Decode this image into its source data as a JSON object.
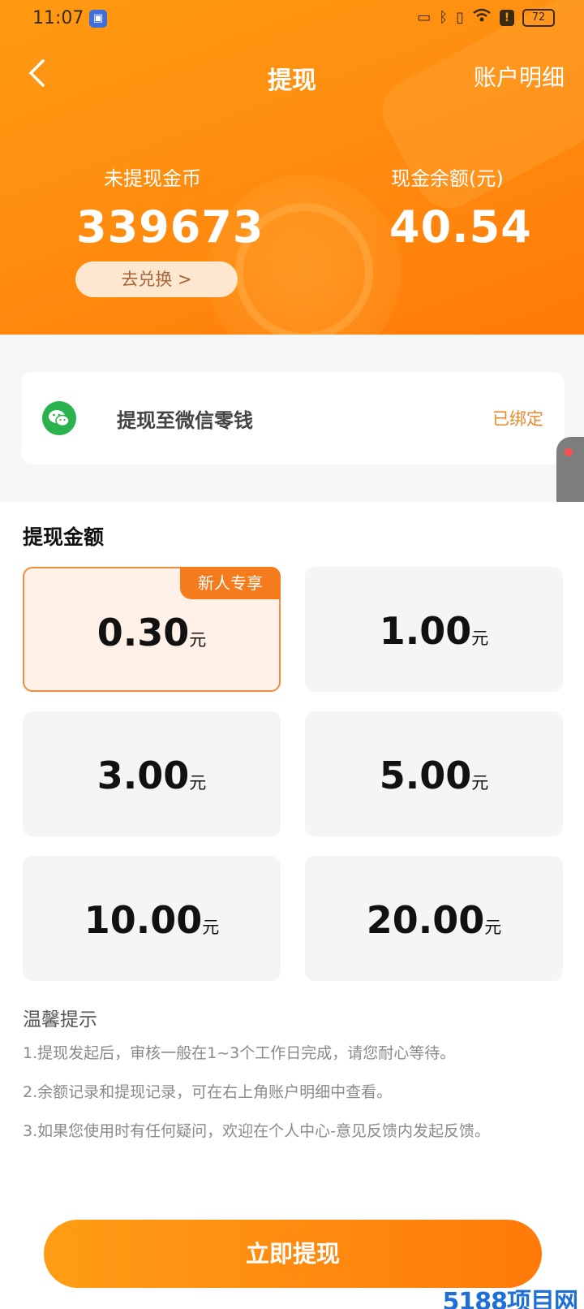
{
  "status_bar": {
    "time": "11:07",
    "battery": "72"
  },
  "nav": {
    "title": "提现",
    "right_link": "账户明细"
  },
  "stats": {
    "coins_label": "未提现金币",
    "coins_value": "339673",
    "cash_label": "现金余额(元)",
    "cash_value": "40.54",
    "exchange_button": "去兑换 >"
  },
  "wechat": {
    "label": "提现至微信零钱",
    "status": "已绑定"
  },
  "amount": {
    "title": "提现金额",
    "unit": "元",
    "badge": "新人专享",
    "options": [
      "0.30",
      "1.00",
      "3.00",
      "5.00",
      "10.00",
      "20.00"
    ]
  },
  "tips": {
    "title": "温馨提示",
    "items": [
      "1.提现发起后，审核一般在1~3个工作日完成，请您耐心等待。",
      "2.余额记录和提现记录，可在右上角账户明细中查看。",
      "3.如果您使用时有任何疑问，欢迎在个人中心-意见反馈内发起反馈。"
    ]
  },
  "submit_button": "立即提现",
  "watermark": "5188项目网",
  "colors": {
    "accent": "#ff8a0e",
    "selected_border": "#f08c3c",
    "wechat_green": "#2ab24f"
  }
}
